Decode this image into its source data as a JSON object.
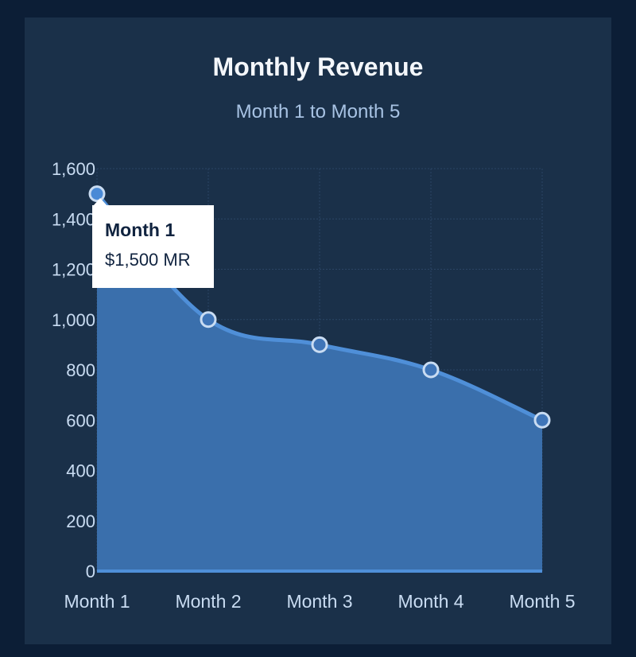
{
  "colors": {
    "page_bg": "#0c1e36",
    "card_bg": "#1a3049",
    "area_fill": "#3a6fac",
    "line": "#4f8fd8",
    "point_fill": "#3f75b8",
    "point_stroke": "#c9dcf2",
    "active_point_fill": "#4a8ad6",
    "grid": "#2b4565",
    "tick_text": "#c9dcf2",
    "title": "#f4f7fb",
    "subtitle": "#a8c3e4",
    "baseline": "#4f8fd8"
  },
  "tooltip": {
    "title": "Month 1",
    "value": "$1,500 MR"
  },
  "chart_data": {
    "type": "area",
    "title": "Monthly Revenue",
    "subtitle": "Month 1 to Month 5",
    "categories": [
      "Month 1",
      "Month 2",
      "Month 3",
      "Month 4",
      "Month 5"
    ],
    "values": [
      1500,
      1000,
      900,
      800,
      600
    ],
    "ylim": [
      0,
      1600
    ],
    "yticks": [
      0,
      200,
      400,
      600,
      800,
      1000,
      1200,
      1400,
      1600
    ],
    "ytick_labels": [
      "0",
      "200",
      "400",
      "600",
      "800",
      "1,000",
      "1,200",
      "1,400",
      "1,600"
    ],
    "grid": true,
    "xlabel": "",
    "ylabel": "",
    "active_point": "Month 1"
  }
}
